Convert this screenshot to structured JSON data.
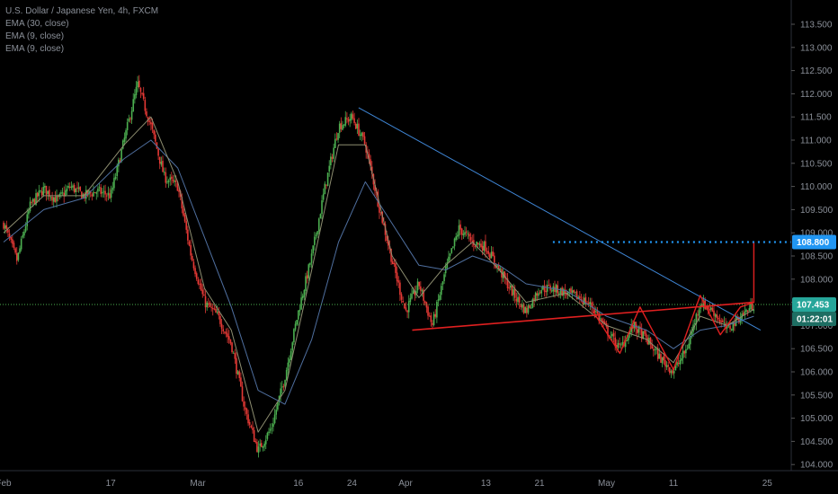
{
  "legend": {
    "symbol_line": "U.S. Dollar / Japanese Yen, 4h, FXCM",
    "indicator_1": "EMA (30, close)",
    "indicator_2": "EMA (9, close)",
    "indicator_3": "EMA (9, close)"
  },
  "colors": {
    "background": "#000000",
    "candle_up": "#4caf50",
    "candle_down": "#e53935",
    "ema_30": "#4f6f9f",
    "ema_9": "#8e8e70",
    "trendline_blue": "#3f86d6",
    "pattern_red": "#e02020",
    "target_blue": "#2196f3",
    "price_line": "#4caf50",
    "axis_text": "#8a8f98"
  },
  "price_axis": {
    "labels": [
      "113.500",
      "113.000",
      "112.500",
      "112.000",
      "111.500",
      "111.000",
      "110.500",
      "110.000",
      "109.500",
      "109.000",
      "108.500",
      "108.000",
      "107.500",
      "107.000",
      "106.500",
      "106.000",
      "105.500",
      "105.000",
      "104.500",
      "104.000"
    ],
    "target_badge": "108.800",
    "current_price_badge": "107.453",
    "countdown_badge": "01:22:01"
  },
  "time_axis": {
    "labels": [
      "Feb",
      "17",
      "Mar",
      "16",
      "24",
      "Apr",
      "13",
      "21",
      "May",
      "11",
      "25"
    ]
  },
  "chart_data": {
    "type": "candlestick",
    "title": "U.S. Dollar / Japanese Yen, 4h, FXCM",
    "ylim": [
      103.95,
      113.95
    ],
    "x_range_days": [
      0,
      95
    ],
    "x_ticks": [
      {
        "day": 0,
        "label": "Feb"
      },
      {
        "day": 16,
        "label": "17"
      },
      {
        "day": 29,
        "label": "Mar"
      },
      {
        "day": 44,
        "label": "16"
      },
      {
        "day": 52,
        "label": "24"
      },
      {
        "day": 60,
        "label": "Apr"
      },
      {
        "day": 72,
        "label": "13"
      },
      {
        "day": 80,
        "label": "21"
      },
      {
        "day": 90,
        "label": "May"
      },
      {
        "day": 100,
        "label": "11"
      },
      {
        "day": 114,
        "label": "25"
      }
    ],
    "price_path": [
      {
        "x": 0,
        "y": 109.2
      },
      {
        "x": 2,
        "y": 108.4
      },
      {
        "x": 4,
        "y": 109.6
      },
      {
        "x": 6,
        "y": 109.95
      },
      {
        "x": 8,
        "y": 109.7
      },
      {
        "x": 10,
        "y": 110.0
      },
      {
        "x": 12,
        "y": 109.8
      },
      {
        "x": 14,
        "y": 109.9
      },
      {
        "x": 16,
        "y": 109.8
      },
      {
        "x": 18,
        "y": 111.0
      },
      {
        "x": 20,
        "y": 112.2
      },
      {
        "x": 22,
        "y": 111.3
      },
      {
        "x": 24,
        "y": 110.2
      },
      {
        "x": 26,
        "y": 110.0
      },
      {
        "x": 28,
        "y": 108.5
      },
      {
        "x": 30,
        "y": 107.5
      },
      {
        "x": 32,
        "y": 107.2
      },
      {
        "x": 34,
        "y": 106.6
      },
      {
        "x": 36,
        "y": 105.2
      },
      {
        "x": 38,
        "y": 104.3
      },
      {
        "x": 40,
        "y": 104.8
      },
      {
        "x": 42,
        "y": 105.9
      },
      {
        "x": 44,
        "y": 107.3
      },
      {
        "x": 46,
        "y": 108.5
      },
      {
        "x": 48,
        "y": 110.0
      },
      {
        "x": 50,
        "y": 111.3
      },
      {
        "x": 52,
        "y": 111.5
      },
      {
        "x": 54,
        "y": 110.9
      },
      {
        "x": 56,
        "y": 109.6
      },
      {
        "x": 58,
        "y": 108.4
      },
      {
        "x": 60,
        "y": 107.3
      },
      {
        "x": 62,
        "y": 107.9
      },
      {
        "x": 64,
        "y": 107.0
      },
      {
        "x": 66,
        "y": 108.2
      },
      {
        "x": 68,
        "y": 109.1
      },
      {
        "x": 70,
        "y": 108.8
      },
      {
        "x": 72,
        "y": 108.7
      },
      {
        "x": 74,
        "y": 108.2
      },
      {
        "x": 76,
        "y": 107.7
      },
      {
        "x": 78,
        "y": 107.3
      },
      {
        "x": 80,
        "y": 107.8
      },
      {
        "x": 82,
        "y": 107.8
      },
      {
        "x": 84,
        "y": 107.7
      },
      {
        "x": 86,
        "y": 107.6
      },
      {
        "x": 88,
        "y": 107.4
      },
      {
        "x": 90,
        "y": 106.9
      },
      {
        "x": 92,
        "y": 106.5
      },
      {
        "x": 94,
        "y": 107.0
      },
      {
        "x": 96,
        "y": 106.7
      },
      {
        "x": 98,
        "y": 106.3
      },
      {
        "x": 100,
        "y": 106.0
      },
      {
        "x": 102,
        "y": 106.5
      },
      {
        "x": 104,
        "y": 107.5
      },
      {
        "x": 106,
        "y": 107.3
      },
      {
        "x": 108,
        "y": 106.9
      },
      {
        "x": 110,
        "y": 107.2
      },
      {
        "x": 112,
        "y": 107.45
      }
    ],
    "ema30_path": [
      {
        "x": 0,
        "y": 108.8
      },
      {
        "x": 6,
        "y": 109.5
      },
      {
        "x": 12,
        "y": 109.75
      },
      {
        "x": 18,
        "y": 110.6
      },
      {
        "x": 22,
        "y": 111.0
      },
      {
        "x": 26,
        "y": 110.4
      },
      {
        "x": 30,
        "y": 108.9
      },
      {
        "x": 34,
        "y": 107.4
      },
      {
        "x": 38,
        "y": 105.6
      },
      {
        "x": 42,
        "y": 105.3
      },
      {
        "x": 46,
        "y": 106.7
      },
      {
        "x": 50,
        "y": 108.8
      },
      {
        "x": 54,
        "y": 110.1
      },
      {
        "x": 58,
        "y": 109.2
      },
      {
        "x": 62,
        "y": 108.3
      },
      {
        "x": 66,
        "y": 108.2
      },
      {
        "x": 70,
        "y": 108.5
      },
      {
        "x": 74,
        "y": 108.3
      },
      {
        "x": 78,
        "y": 107.9
      },
      {
        "x": 84,
        "y": 107.75
      },
      {
        "x": 90,
        "y": 107.2
      },
      {
        "x": 96,
        "y": 106.9
      },
      {
        "x": 100,
        "y": 106.5
      },
      {
        "x": 104,
        "y": 106.9
      },
      {
        "x": 108,
        "y": 107.0
      },
      {
        "x": 112,
        "y": 107.2
      }
    ],
    "ema9_path": [
      {
        "x": 0,
        "y": 109.0
      },
      {
        "x": 6,
        "y": 109.8
      },
      {
        "x": 12,
        "y": 109.8
      },
      {
        "x": 18,
        "y": 110.9
      },
      {
        "x": 22,
        "y": 111.5
      },
      {
        "x": 26,
        "y": 110.1
      },
      {
        "x": 30,
        "y": 107.8
      },
      {
        "x": 34,
        "y": 106.9
      },
      {
        "x": 38,
        "y": 104.7
      },
      {
        "x": 42,
        "y": 105.6
      },
      {
        "x": 46,
        "y": 108.2
      },
      {
        "x": 50,
        "y": 110.9
      },
      {
        "x": 54,
        "y": 110.9
      },
      {
        "x": 58,
        "y": 108.5
      },
      {
        "x": 62,
        "y": 107.6
      },
      {
        "x": 66,
        "y": 108.3
      },
      {
        "x": 70,
        "y": 108.8
      },
      {
        "x": 74,
        "y": 108.2
      },
      {
        "x": 78,
        "y": 107.5
      },
      {
        "x": 84,
        "y": 107.7
      },
      {
        "x": 90,
        "y": 107.0
      },
      {
        "x": 96,
        "y": 106.7
      },
      {
        "x": 100,
        "y": 106.2
      },
      {
        "x": 104,
        "y": 107.2
      },
      {
        "x": 108,
        "y": 107.0
      },
      {
        "x": 112,
        "y": 107.35
      }
    ],
    "drawings": {
      "descending_trendline": [
        {
          "x": 53,
          "y": 111.7
        },
        {
          "x": 113,
          "y": 106.9
        }
      ],
      "neckline": [
        {
          "x": 61,
          "y": 106.9
        },
        {
          "x": 112,
          "y": 107.5
        }
      ],
      "pattern_polyline": [
        {
          "x": 88,
          "y": 107.3
        },
        {
          "x": 92,
          "y": 106.4
        },
        {
          "x": 95,
          "y": 107.4
        },
        {
          "x": 100,
          "y": 106.05
        },
        {
          "x": 104,
          "y": 107.65
        },
        {
          "x": 107,
          "y": 106.8
        },
        {
          "x": 110,
          "y": 107.4
        },
        {
          "x": 112,
          "y": 107.5
        },
        {
          "x": 112,
          "y": 108.8
        }
      ],
      "target_level": 108.8,
      "target_start_x": 82,
      "current_price": 107.453
    }
  }
}
